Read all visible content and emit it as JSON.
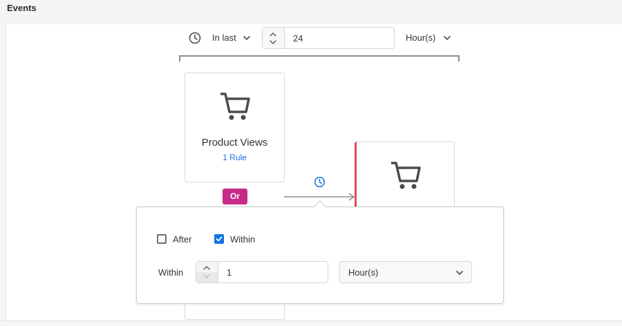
{
  "header": {
    "title": "Events"
  },
  "time_filter": {
    "mode_label": "In last",
    "value": "24",
    "unit_label": "Hour(s)"
  },
  "events": [
    {
      "title": "Product Views",
      "rule_count": "1 Rule",
      "icon": "shopping-cart-icon"
    },
    {
      "icon": "shopping-cart-icon",
      "accent_color": "#e34850"
    }
  ],
  "connector": {
    "operator_label": "Or",
    "operator_color": "#c72a87",
    "icon": "clock-icon"
  },
  "popover": {
    "after_label": "After",
    "after_checked": false,
    "within_checkbox_label": "Within",
    "within_checked": true,
    "within_label": "Within",
    "within_value": "1",
    "unit_label": "Hour(s)"
  },
  "colors": {
    "accent_blue": "#1473e6",
    "or_badge": "#c72a87",
    "selected_event": "#e34850"
  }
}
